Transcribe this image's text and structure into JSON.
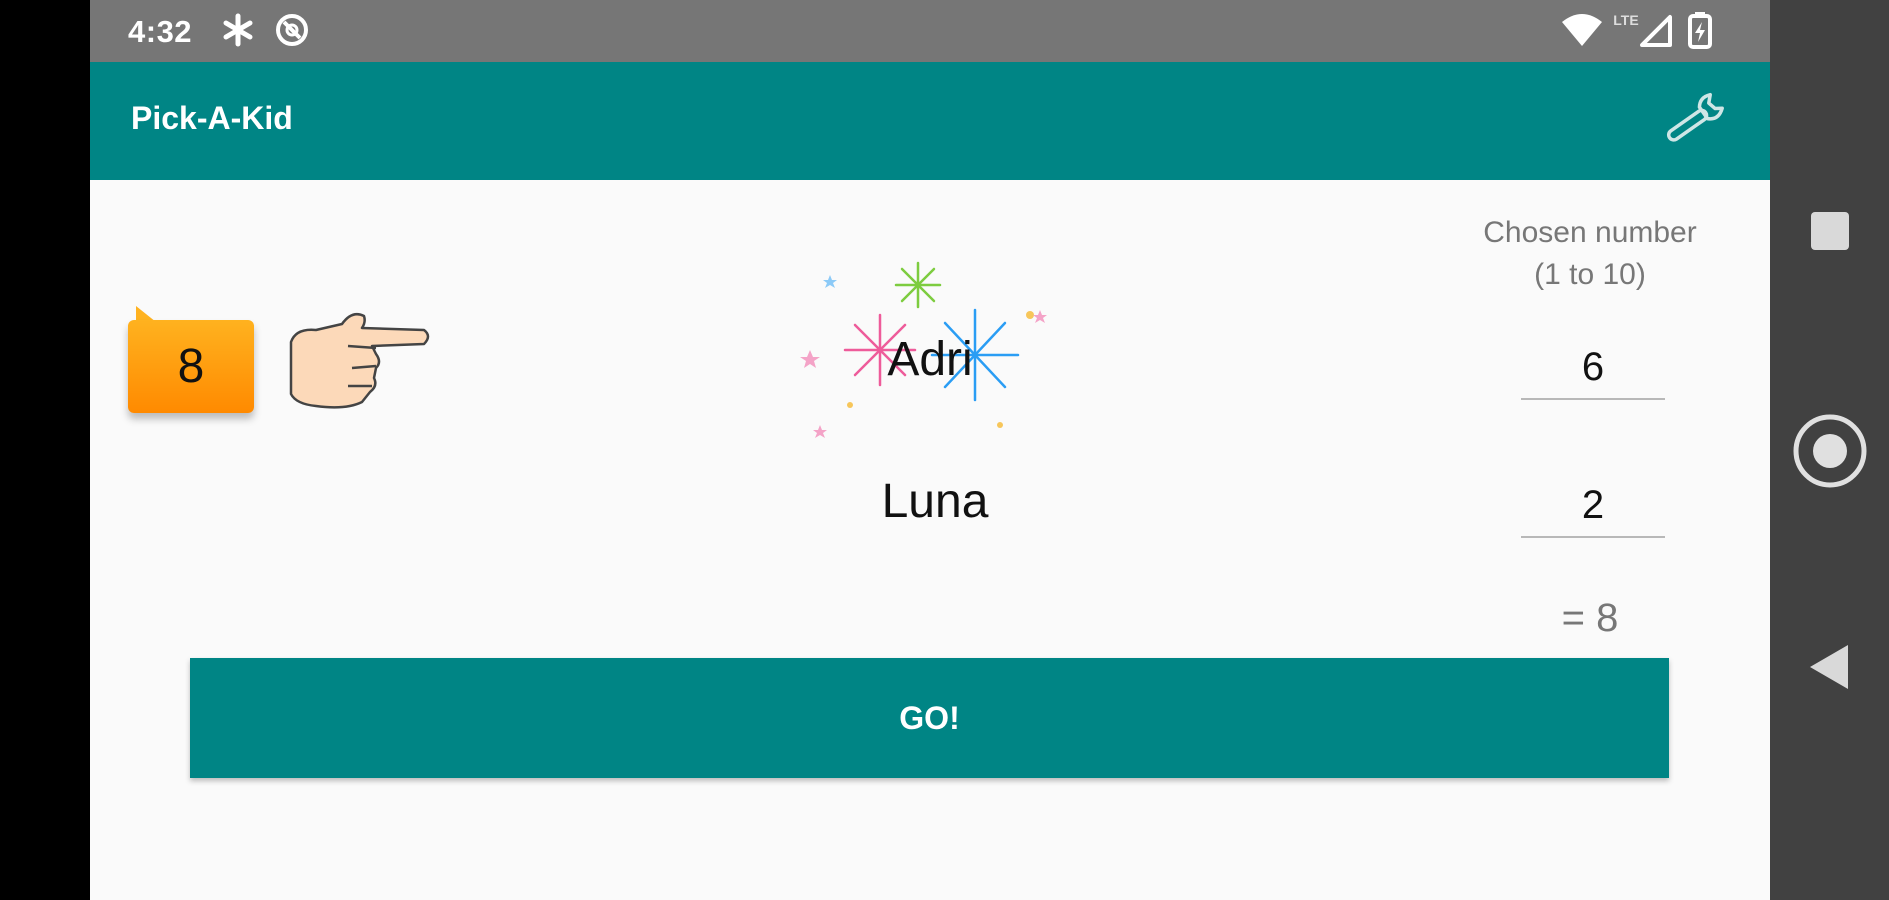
{
  "status_bar": {
    "time": "4:32",
    "network_label": "LTE",
    "icons": [
      "asterisk-icon",
      "data-saver-icon",
      "wifi-icon",
      "signal-icon",
      "battery-icon"
    ]
  },
  "app_bar": {
    "title": "Pick-A-Kid",
    "settings_icon": "wrench-icon"
  },
  "main": {
    "badge_value": "8",
    "pointer_icon": "pointing-hand-icon",
    "celebration_icon": "fireworks-icon",
    "kids": [
      {
        "name": "Adri"
      },
      {
        "name": "Luna"
      }
    ],
    "chosen_label_line1": "Chosen number",
    "chosen_label_line2": "(1 to 10)",
    "numbers": [
      "6",
      "2"
    ],
    "sum": "= 8",
    "go_label": "GO!"
  },
  "nav_bar": {
    "icons": [
      "recents-icon",
      "home-icon",
      "back-icon"
    ]
  },
  "colors": {
    "primary": "#008585",
    "status_bar": "#767676",
    "nav_bar": "#414141",
    "badge": "#ff9a0a",
    "background": "#fafafa"
  }
}
